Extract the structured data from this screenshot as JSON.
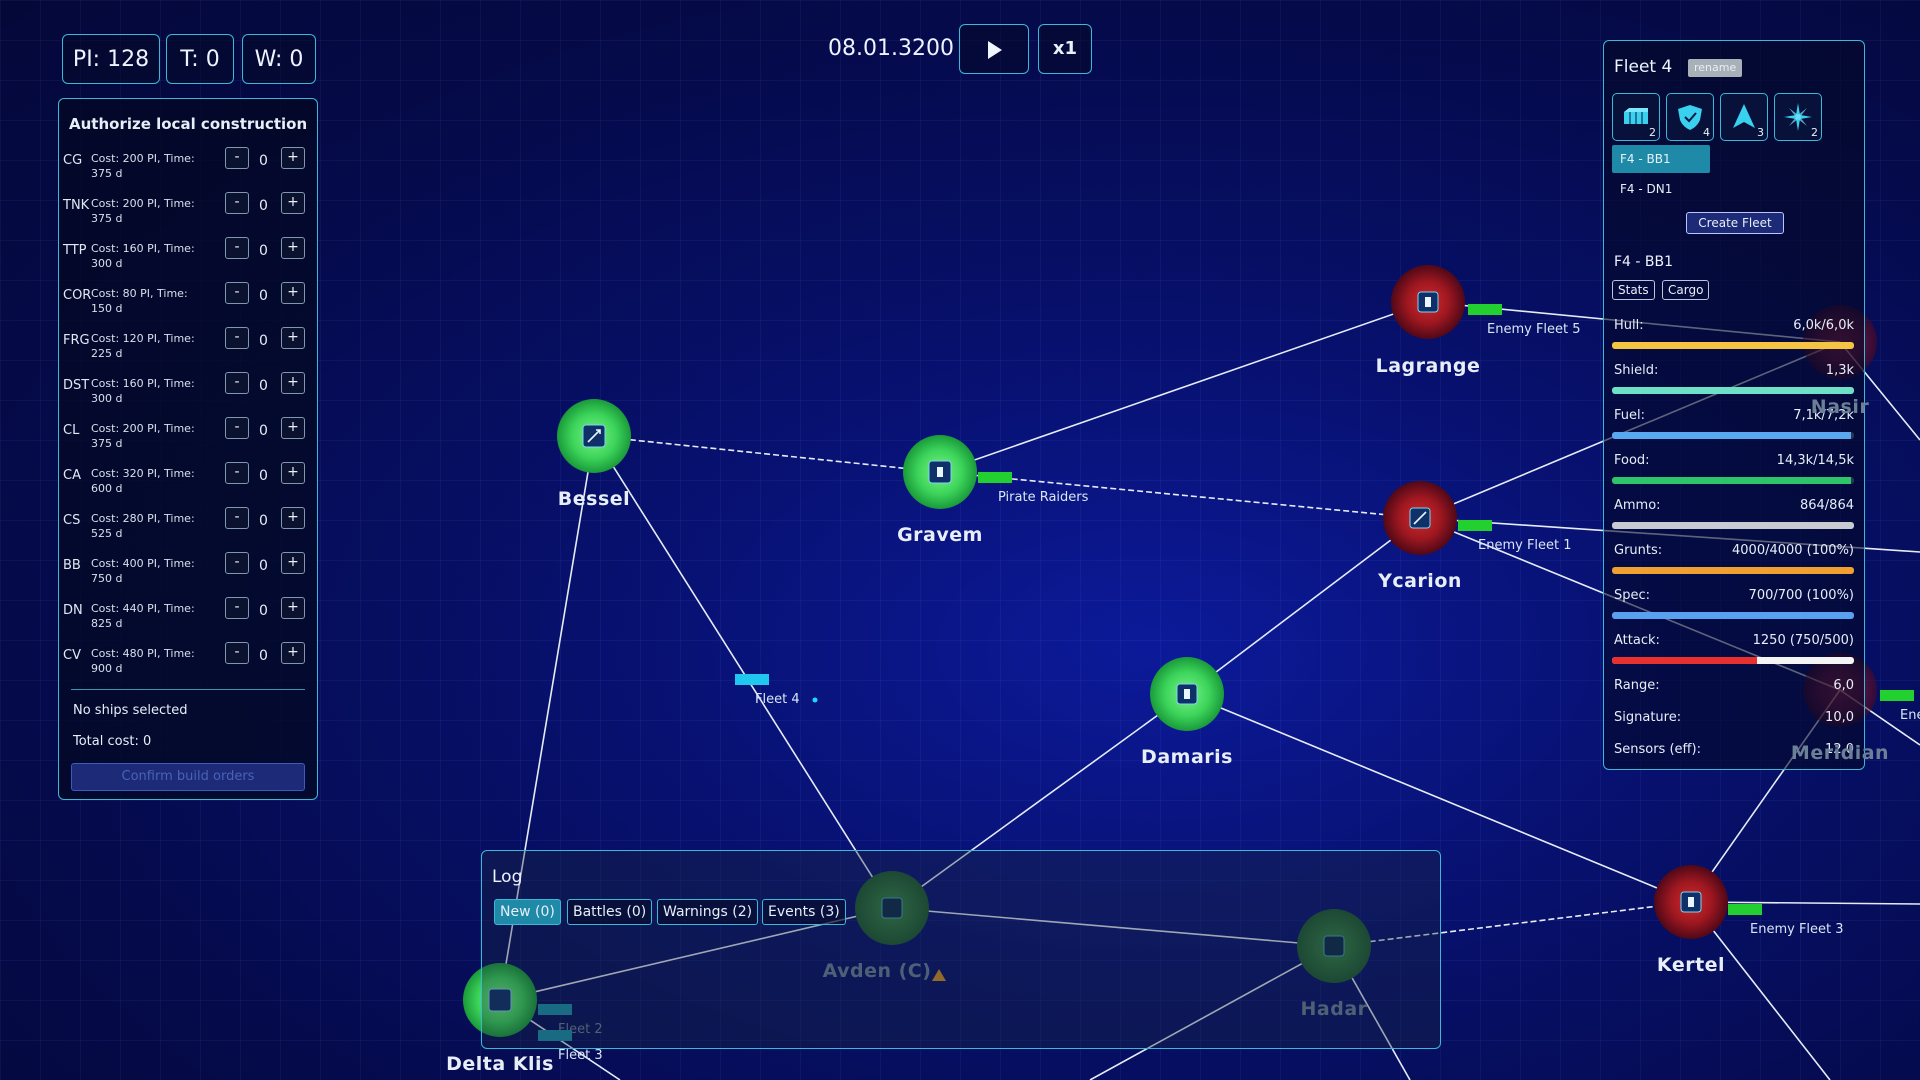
{
  "hud": {
    "pi": "PI: 128",
    "t": "T: 0",
    "w": "W: 0",
    "date": "08.01.3200",
    "speed": "x1",
    "play_icon": "play-icon"
  },
  "build": {
    "title": "Authorize local construction",
    "rows": [
      {
        "code": "CG",
        "cost": "Cost: 200 PI, Time: 375 d",
        "qty": "0"
      },
      {
        "code": "TNK",
        "cost": "Cost: 200 PI, Time: 375 d",
        "qty": "0"
      },
      {
        "code": "TTP",
        "cost": "Cost: 160 PI, Time: 300 d",
        "qty": "0"
      },
      {
        "code": "COR",
        "cost": "Cost: 80 PI, Time: 150 d",
        "qty": "0"
      },
      {
        "code": "FRG",
        "cost": "Cost: 120 PI, Time: 225 d",
        "qty": "0"
      },
      {
        "code": "DST",
        "cost": "Cost: 160 PI, Time: 300 d",
        "qty": "0"
      },
      {
        "code": "CL",
        "cost": "Cost: 200 PI, Time: 375 d",
        "qty": "0"
      },
      {
        "code": "CA",
        "cost": "Cost: 320 PI, Time: 600 d",
        "qty": "0"
      },
      {
        "code": "CS",
        "cost": "Cost: 280 PI, Time: 525 d",
        "qty": "0"
      },
      {
        "code": "BB",
        "cost": "Cost: 400 PI, Time: 750 d",
        "qty": "0"
      },
      {
        "code": "DN",
        "cost": "Cost: 440 PI, Time: 825 d",
        "qty": "0"
      },
      {
        "code": "CV",
        "cost": "Cost: 480 PI, Time: 900 d",
        "qty": "0"
      }
    ],
    "minus": "-",
    "plus": "+",
    "no_ships": "No ships selected",
    "total": "Total cost: 0",
    "confirm": "Confirm build orders"
  },
  "fleet": {
    "title": "Fleet 4",
    "rename": "rename",
    "ship_types": [
      {
        "icon": "cargo-icon",
        "count": "2"
      },
      {
        "icon": "shield-icon",
        "count": "4"
      },
      {
        "icon": "arrow-up-icon",
        "count": "3"
      },
      {
        "icon": "compass-star-icon",
        "count": "2"
      }
    ],
    "ships": [
      "F4 - BB1",
      "F4 - DN1"
    ],
    "create": "Create Fleet",
    "selected": "F4 - BB1",
    "tab_stats": "Stats",
    "tab_cargo": "Cargo",
    "bars": [
      {
        "label": "Hull:",
        "value": "6,0k/6,0k",
        "level": 1.0,
        "color": "#f4c542"
      },
      {
        "label": "Shield:",
        "value": "1,3k",
        "level": 1.0,
        "color": "#6fe0c8"
      },
      {
        "label": "Fuel:",
        "value": "7,1k/7,2k",
        "level": 0.986,
        "color": "#5aa8f0"
      },
      {
        "label": "Food:",
        "value": "14,3k/14,5k",
        "level": 0.986,
        "color": "#2ec46a"
      },
      {
        "label": "Ammo:",
        "value": "864/864",
        "level": 1.0,
        "color": "#c8ccd2"
      },
      {
        "label": "Grunts:",
        "value": "4000/4000 (100%)",
        "level": 1.0,
        "color": "#f0a030"
      },
      {
        "label": "Spec:",
        "value": "700/700 (100%)",
        "level": 1.0,
        "color": "#5aa0f0"
      },
      {
        "label": "Attack:",
        "value": "1250 (750/500)",
        "level": 0.6,
        "color": "#e83030"
      }
    ],
    "plain": [
      {
        "label": "Range:",
        "value": "6,0"
      },
      {
        "label": "Signature:",
        "value": "10,0"
      },
      {
        "label": "Sensors (eff):",
        "value": "12,0"
      }
    ]
  },
  "log": {
    "title": "Log",
    "tabs": [
      "New (0)",
      "Battles (0)",
      "Warnings (2)",
      "Events (3)"
    ]
  },
  "map": {
    "systems": {
      "bessel": "Bessel",
      "gravem": "Gravem",
      "lagrange": "Lagrange",
      "ycarion": "Ycarion",
      "damaris": "Damaris",
      "avden": "Avden  (C)",
      "hadar": "Hadar",
      "kertel": "Kertel",
      "delta": "Delta Klis",
      "nasir": "Nasir",
      "meridian": "Meridian"
    },
    "fleets": {
      "pirate": "Pirate Raiders",
      "enemy5": "Enemy Fleet 5",
      "enemy1": "Enemy Fleet 1",
      "enemy3": "Enemy Fleet 3",
      "fleet4": "Fleet 4",
      "fleet2": "Fleet 2",
      "fleet3": "Fleet 3",
      "ene": "Ene"
    }
  }
}
